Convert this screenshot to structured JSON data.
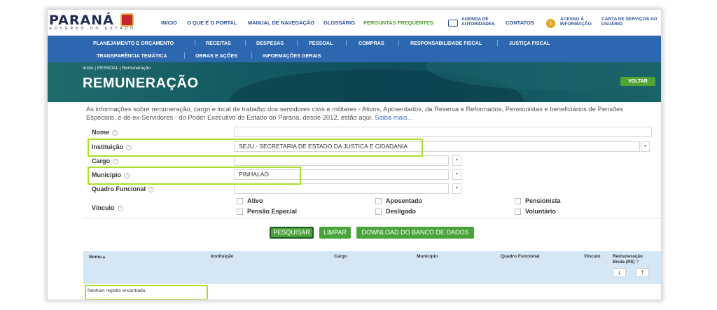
{
  "logo": {
    "word": "PARANÁ",
    "sub": "GOVERNO DO ESTADO"
  },
  "topnav": {
    "inicio": "INÍCIO",
    "oque": "O QUE É O PORTAL",
    "manual": "MANUAL DE NAVEGAÇÃO",
    "glossario": "GLOSSÁRIO",
    "perguntas": "PERGUNTAS FREQUENTES",
    "agenda": "AGENDA DE AUTORIDADES",
    "contatos": "CONTATOS",
    "acesso": "ACESSO À INFORMAÇÃO",
    "carta": "CARTA DE SERVIÇOS AO USUÁRIO",
    "info_glyph": "i"
  },
  "menu": {
    "row1": [
      "PLANEJAMENTO E ORÇAMENTO",
      "RECEITAS",
      "DESPESAS",
      "PESSOAL",
      "COMPRAS",
      "RESPONSABILIDADE FISCAL",
      "JUSTIÇA FISCAL"
    ],
    "row2": [
      "TRANSPARÊNCIA TEMÁTICA",
      "OBRAS E AÇÕES",
      "INFORMAÇÕES GERAIS"
    ]
  },
  "hero": {
    "breadcrumb": "Início  |  PESSOAL  |  Remuneração",
    "title": "REMUNERAÇÃO",
    "voltar": "VOLTAR"
  },
  "intro": {
    "text": "As informações sobre remuneração, cargo e local de trabalho dos servidores civis e militares - Ativos, Aposentados, da Reserva e Reformados, Pensionistas e beneficiários de Pensões Especiais, e de ex-Servidores - do Poder Executivo do Estado do Paraná, desde 2012, estão aqui.",
    "more": "Saiba mais..."
  },
  "form": {
    "help_glyph": "?",
    "dropdown_glyph": "▾",
    "nome": {
      "label": "Nome",
      "value": ""
    },
    "instituicao": {
      "label": "Instituição",
      "value": "SEJU - SECRETARIA DE ESTADO DA JUSTICA E CIDADANIA"
    },
    "cargo": {
      "label": "Cargo",
      "value": ""
    },
    "municipio": {
      "label": "Município",
      "value": "PINHALAO"
    },
    "quadro": {
      "label": "Quadro Funcional",
      "value": ""
    },
    "vinculo": {
      "label": "Vínculo",
      "options": [
        {
          "label": "Ativo",
          "checked": false
        },
        {
          "label": "Aposentado",
          "checked": false
        },
        {
          "label": "Pensionista",
          "checked": false
        },
        {
          "label": "Pensão Especial",
          "checked": false
        },
        {
          "label": "Desligado",
          "checked": false
        },
        {
          "label": "Voluntário",
          "checked": false
        }
      ]
    },
    "buttons": {
      "pesquisar": "PESQUISAR",
      "limpar": "LIMPAR",
      "download": "DOWNLOAD DO BANCO DE DADOS"
    }
  },
  "results": {
    "columns": {
      "nome": "Nome",
      "sort_glyph": "▴",
      "instituicao": "Instituição",
      "cargo": "Cargo",
      "municipio": "Município",
      "quadro": "Quadro Funcional",
      "vinculo": "Vínculo",
      "remuneracao": "Remuneração Bruta (R$)",
      "remuneracao_help": "?"
    },
    "sort_down": "🡓",
    "sort_up": "🡑",
    "empty": "Nenhum registro encontrado."
  },
  "colors": {
    "menu_blue": "#2c67b0",
    "accent_green": "#4aa33a",
    "highlight": "#a7e02a",
    "hero_teal": "#135a62"
  }
}
